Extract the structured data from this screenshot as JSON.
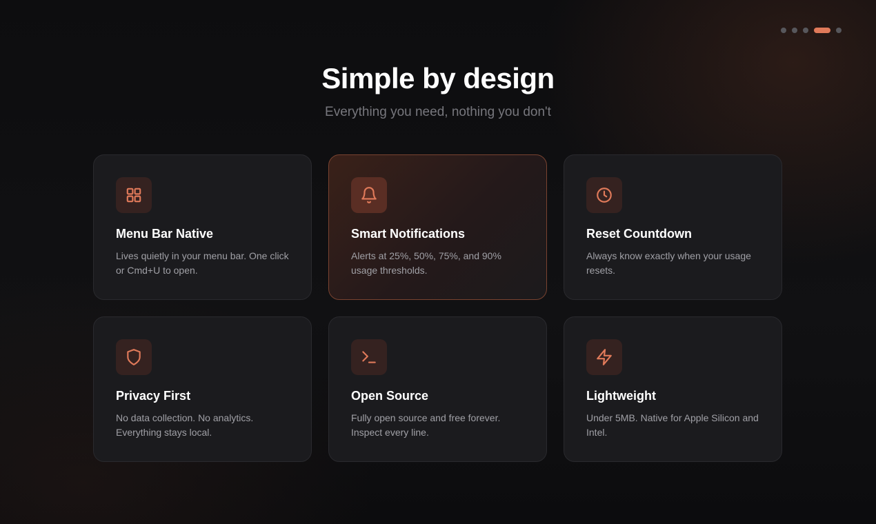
{
  "pagination": {
    "total": 5,
    "active_index": 3
  },
  "hero": {
    "title": "Simple by design",
    "subtitle": "Everything you need, nothing you don't"
  },
  "features": [
    {
      "icon": "grid-icon",
      "title": "Menu Bar Native",
      "description": "Lives quietly in your menu bar. One click or Cmd+U to open."
    },
    {
      "icon": "bell-icon",
      "title": "Smart Notifications",
      "description": "Alerts at 25%, 50%, 75%, and 90% usage thresholds.",
      "highlighted": true
    },
    {
      "icon": "clock-icon",
      "title": "Reset Countdown",
      "description": "Always know exactly when your usage resets."
    },
    {
      "icon": "shield-icon",
      "title": "Privacy First",
      "description": "No data collection. No analytics. Everything stays local."
    },
    {
      "icon": "terminal-icon",
      "title": "Open Source",
      "description": "Fully open source and free forever. Inspect every line."
    },
    {
      "icon": "lightning-icon",
      "title": "Lightweight",
      "description": "Under 5MB. Native for Apple Silicon and Intel."
    }
  ],
  "colors": {
    "accent": "#e07a5a",
    "background": "#0e0e10",
    "card": "#1b1b1e"
  }
}
